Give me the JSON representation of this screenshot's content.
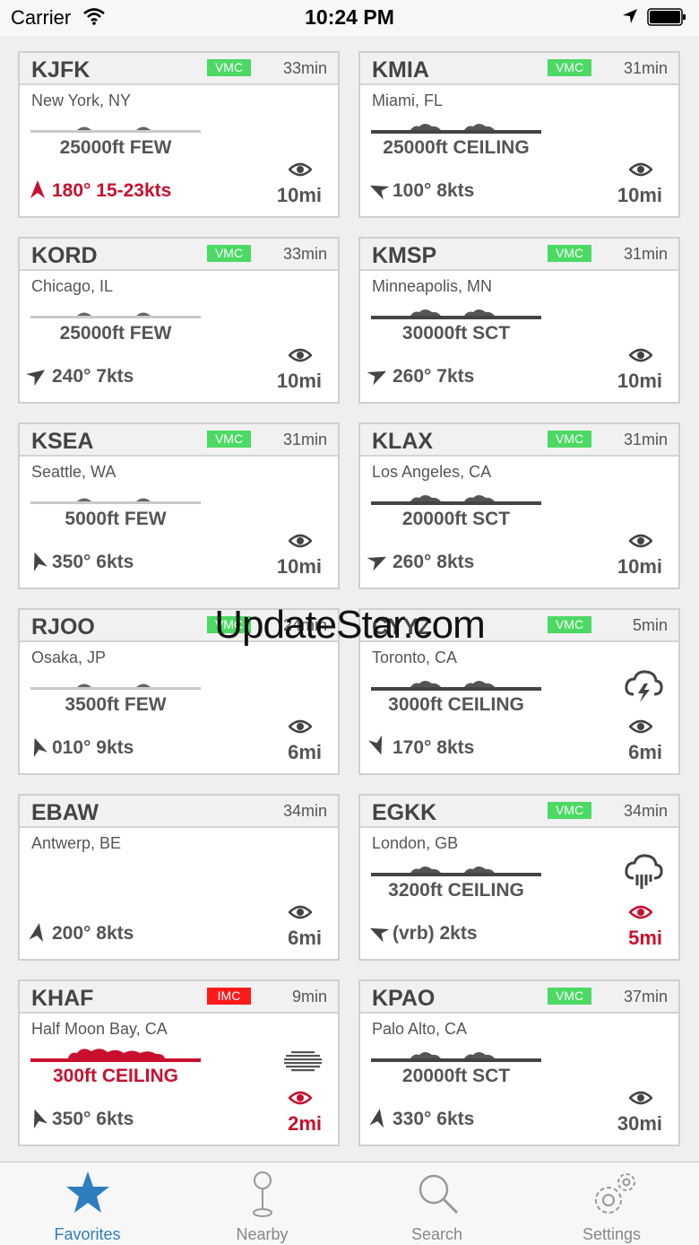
{
  "status_bar": {
    "carrier": "Carrier",
    "time": "10:24 PM"
  },
  "watermark": "UpdateStar.com",
  "colors": {
    "vmc": "#4cd964",
    "imc": "#ff1a1a",
    "alert": "#c8102e",
    "accent": "#2e7dbf"
  },
  "stations": [
    {
      "id": "KJFK",
      "category": "VMC",
      "age": "33min",
      "location": "New York, NY",
      "clouds": "25000ft FEW",
      "wind": "180° 15-23kts",
      "visibility": "10mi",
      "wind_icon": "arrow-icon",
      "weather_icon": "",
      "alert_wind": true,
      "alert_vis": false,
      "alert_clouds": false
    },
    {
      "id": "KMIA",
      "category": "VMC",
      "age": "31min",
      "location": "Miami, FL",
      "clouds": "25000ft CEILING",
      "wind": "100° 8kts",
      "visibility": "10mi",
      "wind_icon": "arrow-icon",
      "weather_icon": "",
      "alert_wind": false,
      "alert_vis": false,
      "alert_clouds": false
    },
    {
      "id": "KORD",
      "category": "VMC",
      "age": "33min",
      "location": "Chicago, IL",
      "clouds": "25000ft FEW",
      "wind": "240° 7kts",
      "visibility": "10mi",
      "wind_icon": "arrow-icon",
      "weather_icon": "",
      "alert_wind": false,
      "alert_vis": false,
      "alert_clouds": false
    },
    {
      "id": "KMSP",
      "category": "VMC",
      "age": "31min",
      "location": "Minneapolis, MN",
      "clouds": "30000ft SCT",
      "wind": "260° 7kts",
      "visibility": "10mi",
      "wind_icon": "arrow-icon",
      "weather_icon": "",
      "alert_wind": false,
      "alert_vis": false,
      "alert_clouds": false
    },
    {
      "id": "KSEA",
      "category": "VMC",
      "age": "31min",
      "location": "Seattle, WA",
      "clouds": "5000ft FEW",
      "wind": "350° 6kts",
      "visibility": "10mi",
      "wind_icon": "arrow-icon",
      "weather_icon": "",
      "alert_wind": false,
      "alert_vis": false,
      "alert_clouds": false
    },
    {
      "id": "KLAX",
      "category": "VMC",
      "age": "31min",
      "location": "Los Angeles, CA",
      "clouds": "20000ft SCT",
      "wind": "260° 8kts",
      "visibility": "10mi",
      "wind_icon": "arrow-icon",
      "weather_icon": "",
      "alert_wind": false,
      "alert_vis": false,
      "alert_clouds": false
    },
    {
      "id": "RJOO",
      "category": "VMC",
      "age": "24min",
      "location": "Osaka, JP",
      "clouds": "3500ft FEW",
      "wind": "010° 9kts",
      "visibility": "6mi",
      "wind_icon": "arrow-icon",
      "weather_icon": "",
      "alert_wind": false,
      "alert_vis": false,
      "alert_clouds": false
    },
    {
      "id": "CYYZ",
      "category": "VMC",
      "age": "5min",
      "location": "Toronto, CA",
      "clouds": "3000ft CEILING",
      "wind": "170° 8kts",
      "visibility": "6mi",
      "wind_icon": "arrow-icon",
      "weather_icon": "thunderstorm-icon",
      "alert_wind": false,
      "alert_vis": false,
      "alert_clouds": false
    },
    {
      "id": "EBAW",
      "category": "",
      "age": "34min",
      "location": "Antwerp, BE",
      "clouds": "",
      "wind": "200° 8kts",
      "visibility": "6mi",
      "wind_icon": "arrow-icon",
      "weather_icon": "",
      "alert_wind": false,
      "alert_vis": false,
      "alert_clouds": false
    },
    {
      "id": "EGKK",
      "category": "VMC",
      "age": "34min",
      "location": "London, GB",
      "clouds": "3200ft CEILING",
      "wind": "(vrb) 2kts",
      "visibility": "5mi",
      "wind_icon": "arrow-icon",
      "weather_icon": "rain-icon",
      "alert_wind": false,
      "alert_vis": true,
      "alert_clouds": false
    },
    {
      "id": "KHAF",
      "category": "IMC",
      "age": "9min",
      "location": "Half Moon Bay, CA",
      "clouds": "300ft CEILING",
      "wind": "350° 6kts",
      "visibility": "2mi",
      "wind_icon": "arrow-icon",
      "weather_icon": "fog-icon",
      "alert_wind": false,
      "alert_vis": true,
      "alert_clouds": true
    },
    {
      "id": "KPAO",
      "category": "VMC",
      "age": "37min",
      "location": "Palo Alto, CA",
      "clouds": "20000ft SCT",
      "wind": "330° 6kts",
      "visibility": "30mi",
      "wind_icon": "arrow-icon",
      "weather_icon": "",
      "alert_wind": false,
      "alert_vis": false,
      "alert_clouds": false
    }
  ],
  "tabs": [
    {
      "label": "Favorites",
      "icon": "star-icon",
      "active": true
    },
    {
      "label": "Nearby",
      "icon": "location-pin-icon",
      "active": false
    },
    {
      "label": "Search",
      "icon": "magnifier-icon",
      "active": false
    },
    {
      "label": "Settings",
      "icon": "gear-icon",
      "active": false
    }
  ]
}
